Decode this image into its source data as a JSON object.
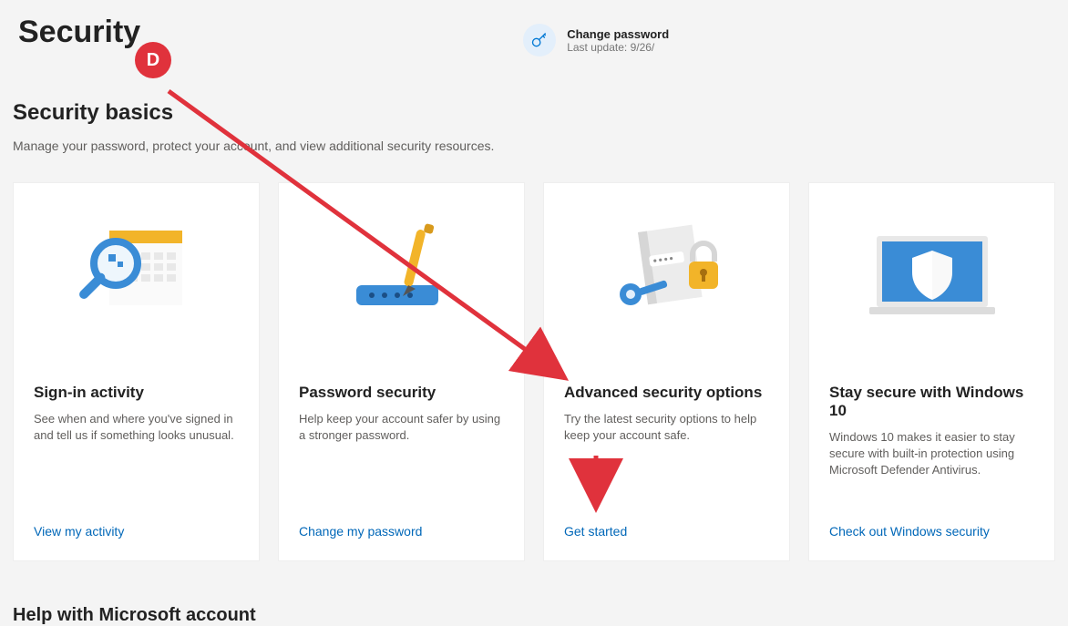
{
  "header": {
    "title": "Security",
    "change_password": {
      "label": "Change password",
      "last_update_prefix": "Last update: ",
      "last_update_date": "9/26/"
    }
  },
  "section": {
    "heading": "Security basics",
    "sub": "Manage your password, protect your account, and view additional security resources."
  },
  "cards": [
    {
      "title": "Sign-in activity",
      "desc": "See when and where you've signed in and tell us if something looks unusual.",
      "link": "View my activity"
    },
    {
      "title": "Password security",
      "desc": "Help keep your account safer by using a stronger password.",
      "link": "Change my password"
    },
    {
      "title": "Advanced security options",
      "desc": "Try the latest security options to help keep your account safe.",
      "link": "Get started"
    },
    {
      "title": "Stay secure with Windows 10",
      "desc": "Windows 10 makes it easier to stay secure with built-in protection using Microsoft Defender Antivirus.",
      "link": "Check out Windows security"
    }
  ],
  "help_heading": "Help with Microsoft account",
  "annotation": {
    "badge_letter": "D"
  }
}
